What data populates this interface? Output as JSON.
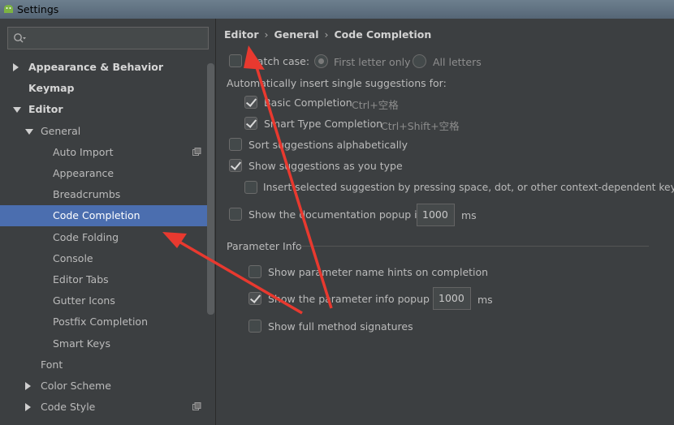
{
  "window": {
    "title": "Settings"
  },
  "search": {
    "placeholder": ""
  },
  "sidebar": {
    "items": [
      {
        "label": "Appearance & Behavior",
        "indent": 0,
        "arrow": "right",
        "bold": true,
        "selected": false,
        "project_icon": false
      },
      {
        "label": "Keymap",
        "indent": 0,
        "arrow": "none",
        "bold": true,
        "selected": false,
        "project_icon": false
      },
      {
        "label": "Editor",
        "indent": 0,
        "arrow": "down",
        "bold": true,
        "selected": false,
        "project_icon": false
      },
      {
        "label": "General",
        "indent": 1,
        "arrow": "down",
        "bold": false,
        "selected": false,
        "project_icon": false
      },
      {
        "label": "Auto Import",
        "indent": 2,
        "arrow": "none",
        "bold": false,
        "selected": false,
        "project_icon": true
      },
      {
        "label": "Appearance",
        "indent": 2,
        "arrow": "none",
        "bold": false,
        "selected": false,
        "project_icon": false
      },
      {
        "label": "Breadcrumbs",
        "indent": 2,
        "arrow": "none",
        "bold": false,
        "selected": false,
        "project_icon": false
      },
      {
        "label": "Code Completion",
        "indent": 2,
        "arrow": "none",
        "bold": false,
        "selected": true,
        "project_icon": false
      },
      {
        "label": "Code Folding",
        "indent": 2,
        "arrow": "none",
        "bold": false,
        "selected": false,
        "project_icon": false
      },
      {
        "label": "Console",
        "indent": 2,
        "arrow": "none",
        "bold": false,
        "selected": false,
        "project_icon": false
      },
      {
        "label": "Editor Tabs",
        "indent": 2,
        "arrow": "none",
        "bold": false,
        "selected": false,
        "project_icon": false
      },
      {
        "label": "Gutter Icons",
        "indent": 2,
        "arrow": "none",
        "bold": false,
        "selected": false,
        "project_icon": false
      },
      {
        "label": "Postfix Completion",
        "indent": 2,
        "arrow": "none",
        "bold": false,
        "selected": false,
        "project_icon": false
      },
      {
        "label": "Smart Keys",
        "indent": 2,
        "arrow": "none",
        "bold": false,
        "selected": false,
        "project_icon": false
      },
      {
        "label": "Font",
        "indent": 1,
        "arrow": "none",
        "bold": false,
        "selected": false,
        "project_icon": false
      },
      {
        "label": "Color Scheme",
        "indent": 1,
        "arrow": "right",
        "bold": false,
        "selected": false,
        "project_icon": false
      },
      {
        "label": "Code Style",
        "indent": 1,
        "arrow": "right",
        "bold": false,
        "selected": false,
        "project_icon": true
      }
    ]
  },
  "breadcrumb": {
    "part1": "Editor",
    "part2": "General",
    "part3": "Code Completion"
  },
  "settings": {
    "match_case": {
      "label": "Match case:",
      "checked": false
    },
    "first_letter": {
      "label": "First letter only",
      "selected": true
    },
    "all_letters": {
      "label": "All letters",
      "selected": false
    },
    "auto_insert_heading": "Automatically insert single suggestions for:",
    "basic_completion": {
      "label": "Basic Completion",
      "shortcut": "Ctrl+空格",
      "checked": true
    },
    "smart_type": {
      "label": "Smart Type Completion",
      "shortcut": "Ctrl+Shift+空格",
      "checked": true
    },
    "sort_alpha": {
      "label": "Sort suggestions alphabetically",
      "checked": false
    },
    "show_as_type": {
      "label": "Show suggestions as you type",
      "checked": true
    },
    "insert_selected": {
      "label": "Insert selected suggestion by pressing space, dot, or other context-dependent keys",
      "checked": false
    },
    "doc_popup": {
      "label": "Show the documentation popup in",
      "value": "1000",
      "unit": "ms",
      "checked": false
    }
  },
  "param_info": {
    "heading": "Parameter Info",
    "name_hints": {
      "label": "Show parameter name hints on completion",
      "checked": false
    },
    "info_popup": {
      "label": "Show the parameter info popup in",
      "value": "1000",
      "unit": "ms",
      "checked": true
    },
    "full_signatures": {
      "label": "Show full method signatures",
      "checked": false
    }
  },
  "colors": {
    "selection": "#4b6eaf",
    "background": "#3c3f41",
    "annotation_arrow": "#e8392f"
  }
}
